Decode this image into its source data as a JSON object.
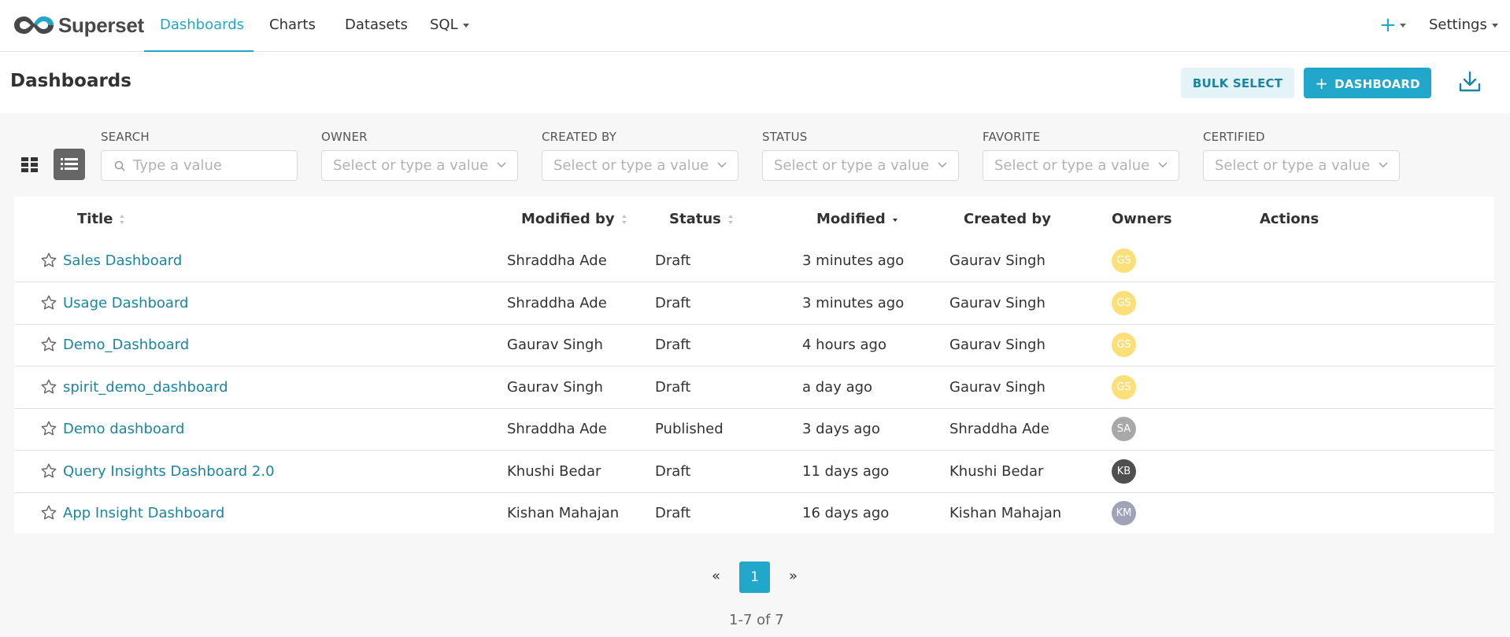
{
  "nav": {
    "brand": "Superset",
    "items": [
      {
        "label": "Dashboards",
        "active": true
      },
      {
        "label": "Charts"
      },
      {
        "label": "Datasets"
      },
      {
        "label": "SQL"
      }
    ],
    "plus": "+",
    "settings": "Settings"
  },
  "header": {
    "title": "Dashboards",
    "bulk_select": "BULK SELECT",
    "new_dashboard": "DASHBOARD",
    "new_dashboard_icon": "+"
  },
  "filters": {
    "search": {
      "label": "SEARCH",
      "placeholder": "Type a value"
    },
    "owner": {
      "label": "OWNER",
      "placeholder": "Select or type a value"
    },
    "created_by": {
      "label": "CREATED BY",
      "placeholder": "Select or type a value"
    },
    "status": {
      "label": "STATUS",
      "placeholder": "Select or type a value"
    },
    "favorite": {
      "label": "FAVORITE",
      "placeholder": "Select or type a value"
    },
    "certified": {
      "label": "CERTIFIED",
      "placeholder": "Select or type a value"
    }
  },
  "table": {
    "columns": [
      "Title",
      "Modified by",
      "Status",
      "Modified",
      "Created by",
      "Owners",
      "Actions"
    ],
    "rows": [
      {
        "title": "Sales Dashboard",
        "modified_by": "Shraddha Ade",
        "status": "Draft",
        "modified": "3 minutes ago",
        "created_by": "Gaurav Singh",
        "owner_initials": "GS",
        "owner_color": "#fbe07a"
      },
      {
        "title": "Usage Dashboard",
        "modified_by": "Shraddha Ade",
        "status": "Draft",
        "modified": "3 minutes ago",
        "created_by": "Gaurav Singh",
        "owner_initials": "GS",
        "owner_color": "#fbe07a"
      },
      {
        "title": "Demo_Dashboard",
        "modified_by": "Gaurav Singh",
        "status": "Draft",
        "modified": "4 hours ago",
        "created_by": "Gaurav Singh",
        "owner_initials": "GS",
        "owner_color": "#fbe07a"
      },
      {
        "title": "spirit_demo_dashboard",
        "modified_by": "Gaurav Singh",
        "status": "Draft",
        "modified": "a day ago",
        "created_by": "Gaurav Singh",
        "owner_initials": "GS",
        "owner_color": "#fbe07a"
      },
      {
        "title": "Demo dashboard",
        "modified_by": "Shraddha Ade",
        "status": "Published",
        "modified": "3 days ago",
        "created_by": "Shraddha Ade",
        "owner_initials": "SA",
        "owner_color": "#a8a8a8"
      },
      {
        "title": "Query Insights Dashboard 2.0",
        "modified_by": "Khushi Bedar",
        "status": "Draft",
        "modified": "11 days ago",
        "created_by": "Khushi Bedar",
        "owner_initials": "KB",
        "owner_color": "#4f4f4f"
      },
      {
        "title": "App Insight Dashboard",
        "modified_by": "Kishan Mahajan",
        "status": "Draft",
        "modified": "16 days ago",
        "created_by": "Kishan Mahajan",
        "owner_initials": "KM",
        "owner_color": "#a0a3b8"
      }
    ]
  },
  "pagination": {
    "prev": "«",
    "current": "1",
    "next": "»",
    "summary": "1-7 of 7"
  },
  "colors": {
    "accent": "#20a7c9",
    "link": "#1985a0",
    "bulk_bg": "#e4f3f7"
  }
}
